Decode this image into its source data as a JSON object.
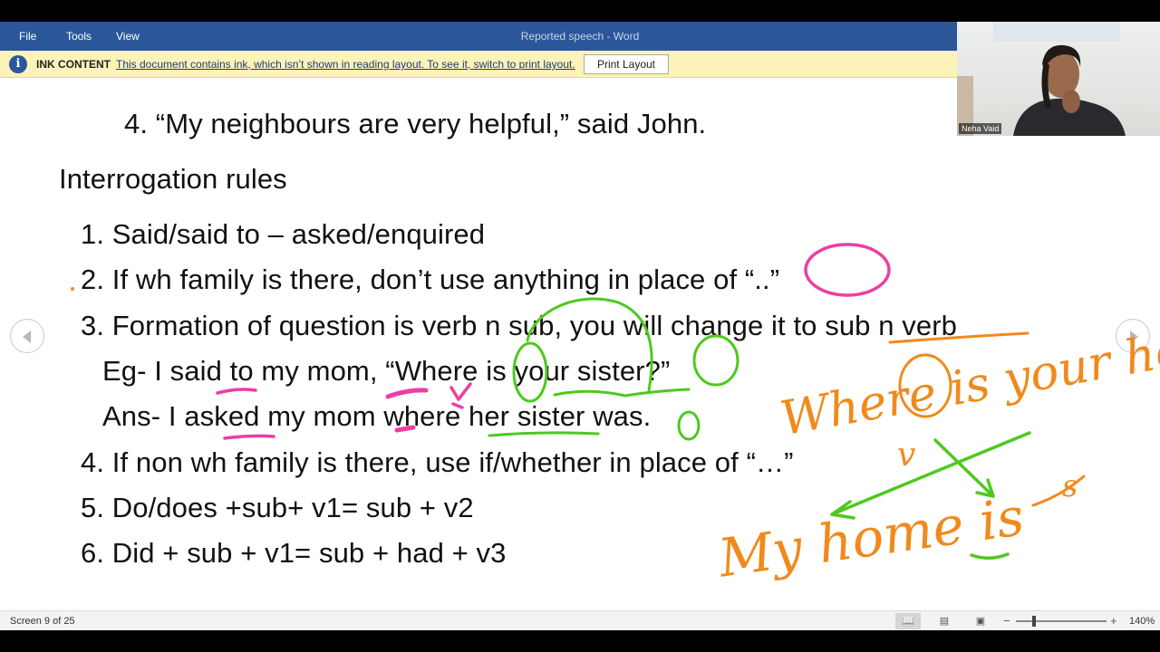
{
  "titlebar": {
    "menus": [
      "File",
      "Tools",
      "View"
    ],
    "doc_title": "Reported speech  -  Word"
  },
  "infobar": {
    "title": "INK CONTENT",
    "message": "This document contains ink, which isn’t shown in reading layout. To see it, switch to print layout.",
    "button_label": "Print Layout"
  },
  "document": {
    "item4_prev": "4. “My neighbours are very helpful,” said John.",
    "heading": "Interrogation rules",
    "rules": [
      "1. Said/said to – asked/enquired",
      "2. If wh family is there, don’t use anything in place of “..”",
      "3. Formation of question is verb n sub, you will change it to sub n verb",
      "Eg- I said to my mom, “Where is your sister?”",
      "Ans- I asked my mom where her sister was.",
      "4. If non wh family is there, use if/whether in place of “…”",
      "5. Do/does +sub+ v1= sub + v2",
      "6. Did + sub + v1= sub + had + v3"
    ]
  },
  "handwriting": {
    "line1": "Where is your home?",
    "line2": "My home is",
    "v_mark": "v",
    "s_mark": "s",
    "is_mark": "is"
  },
  "statusbar": {
    "screen_info": "Screen 9 of 25",
    "zoom_minus": "−",
    "zoom_plus": "+",
    "zoom_level": "140%"
  },
  "video": {
    "participant_name": "Neha Vaid"
  },
  "colors": {
    "titlebar": "#2b579a",
    "infobar": "#fdf3b8",
    "ink_pink": "#ec3ea3",
    "ink_green": "#4dc91e",
    "ink_orange": "#f08a1c"
  }
}
